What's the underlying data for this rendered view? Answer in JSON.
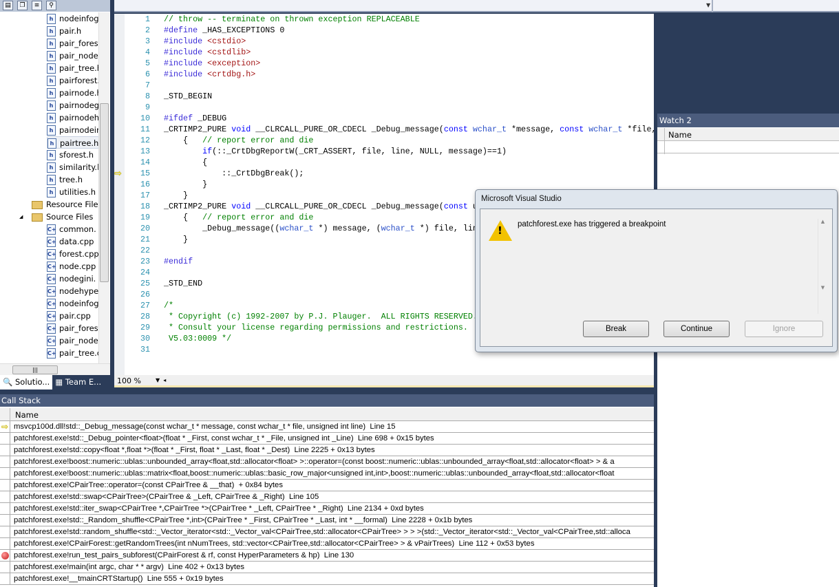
{
  "solution_explorer": {
    "toolbar_icons": [
      "properties-icon",
      "show-all-files-icon",
      "view-code-icon",
      "class-view-icon"
    ],
    "items": [
      {
        "label": "nodeinfog",
        "type": "h",
        "indent": 1
      },
      {
        "label": "pair.h",
        "type": "h",
        "indent": 1
      },
      {
        "label": "pair_forest",
        "type": "h",
        "indent": 1
      },
      {
        "label": "pair_node",
        "type": "h",
        "indent": 1
      },
      {
        "label": "pair_tree.h",
        "type": "h",
        "indent": 1
      },
      {
        "label": "pairforest.",
        "type": "h",
        "indent": 1
      },
      {
        "label": "pairnode.h",
        "type": "h",
        "indent": 1
      },
      {
        "label": "pairnodeg",
        "type": "h",
        "indent": 1
      },
      {
        "label": "pairnodeh",
        "type": "h",
        "indent": 1
      },
      {
        "label": "pairnodeir",
        "type": "h",
        "indent": 1
      },
      {
        "label": "pairtree.h",
        "type": "h",
        "indent": 1,
        "selected": true
      },
      {
        "label": "sforest.h",
        "type": "h",
        "indent": 1
      },
      {
        "label": "similarity.l",
        "type": "h",
        "indent": 1
      },
      {
        "label": "tree.h",
        "type": "h",
        "indent": 1
      },
      {
        "label": "utilities.h",
        "type": "h",
        "indent": 1
      },
      {
        "label": "Resource Files",
        "type": "folder",
        "indent": 0
      },
      {
        "label": "Source Files",
        "type": "folder-open",
        "indent": 0
      },
      {
        "label": "common.",
        "type": "cpp",
        "indent": 1
      },
      {
        "label": "data.cpp",
        "type": "cpp",
        "indent": 1
      },
      {
        "label": "forest.cpp",
        "type": "cpp",
        "indent": 1
      },
      {
        "label": "node.cpp",
        "type": "cpp",
        "indent": 1
      },
      {
        "label": "nodegini.",
        "type": "cpp",
        "indent": 1
      },
      {
        "label": "nodehype",
        "type": "cpp",
        "indent": 1
      },
      {
        "label": "nodeinfog",
        "type": "cpp",
        "indent": 1
      },
      {
        "label": "pair.cpp",
        "type": "cpp",
        "indent": 1
      },
      {
        "label": "pair_forest",
        "type": "cpp",
        "indent": 1
      },
      {
        "label": "pair_node",
        "type": "cpp",
        "indent": 1
      },
      {
        "label": "pair_tree.c",
        "type": "cpp",
        "indent": 1
      }
    ],
    "tabs": [
      {
        "label": "Solutio...",
        "active": true
      },
      {
        "label": "Team E...",
        "active": false
      }
    ]
  },
  "editor": {
    "current_line": 15,
    "zoom": "100 %",
    "lines": [
      [
        [
          "// throw -- terminate on thrown exception REPLACEABLE",
          "cm"
        ]
      ],
      [
        [
          "#define",
          "pp"
        ],
        [
          " _HAS_EXCEPTIONS 0",
          ""
        ]
      ],
      [
        [
          "#include",
          "pp"
        ],
        [
          " ",
          ""
        ],
        [
          "<cstdio>",
          "st"
        ]
      ],
      [
        [
          "#include",
          "pp"
        ],
        [
          " ",
          ""
        ],
        [
          "<cstdlib>",
          "st"
        ]
      ],
      [
        [
          "#include",
          "pp"
        ],
        [
          " ",
          ""
        ],
        [
          "<exception>",
          "st"
        ]
      ],
      [
        [
          "#include",
          "pp"
        ],
        [
          " ",
          ""
        ],
        [
          "<crtdbg.h>",
          "st"
        ]
      ],
      [],
      [
        [
          "_STD_BEGIN",
          ""
        ]
      ],
      [],
      [
        [
          "#ifdef",
          "pp"
        ],
        [
          " _DEBUG",
          ""
        ]
      ],
      [
        [
          "_CRTIMP2_PURE ",
          ""
        ],
        [
          "void",
          "kw"
        ],
        [
          " __CLRCALL_PURE_OR_CDECL _Debug_message(",
          ""
        ],
        [
          "const",
          "kw"
        ],
        [
          " ",
          ""
        ],
        [
          "wchar_t",
          "ty"
        ],
        [
          " *message, ",
          ""
        ],
        [
          "const",
          "kw"
        ],
        [
          " ",
          ""
        ],
        [
          "wchar_t",
          "ty"
        ],
        [
          " *file,",
          ""
        ]
      ],
      [
        [
          "    {   ",
          ""
        ],
        [
          "// report error and die",
          "cm"
        ]
      ],
      [
        [
          "        ",
          ""
        ],
        [
          "if",
          "kw"
        ],
        [
          "(::_CrtDbgReportW(_CRT_ASSERT, file, line, NULL, message)==1)",
          ""
        ]
      ],
      [
        [
          "        {",
          ""
        ]
      ],
      [
        [
          "            ::_CrtDbgBreak();",
          ""
        ]
      ],
      [
        [
          "        }",
          ""
        ]
      ],
      [
        [
          "    }",
          ""
        ]
      ],
      [
        [
          "_CRTIMP2_PURE ",
          ""
        ],
        [
          "void",
          "kw"
        ],
        [
          " __CLRCALL_PURE_OR_CDECL _Debug_message(",
          ""
        ],
        [
          "const",
          "kw"
        ],
        [
          " u",
          ""
        ]
      ],
      [
        [
          "    {   ",
          ""
        ],
        [
          "// report error and die",
          "cm"
        ]
      ],
      [
        [
          "        _Debug_message((",
          ""
        ],
        [
          "wchar_t",
          "ty"
        ],
        [
          " *) message, (",
          ""
        ],
        [
          "wchar_t",
          "ty"
        ],
        [
          " *) file, lin",
          ""
        ]
      ],
      [
        [
          "    }",
          ""
        ]
      ],
      [],
      [
        [
          "#endif",
          "pp"
        ]
      ],
      [],
      [
        [
          "_STD_END",
          ""
        ]
      ],
      [],
      [
        [
          "/*",
          "cm"
        ]
      ],
      [
        [
          " * Copyright (c) 1992-2007 by P.J. Plauger.  ALL RIGHTS RESERVED.",
          "cm"
        ]
      ],
      [
        [
          " * Consult your license regarding permissions and restrictions.",
          "cm"
        ]
      ],
      [
        [
          " V5.03:0009 */",
          "cm"
        ]
      ],
      []
    ]
  },
  "call_stack": {
    "title": "Call Stack",
    "column": "Name",
    "rows": [
      {
        "marker": "current",
        "text": "msvcp100d.dll!std::_Debug_message(const wchar_t * message, const wchar_t * file, unsigned int line)  Line 15"
      },
      {
        "marker": "",
        "text": "patchforest.exe!std::_Debug_pointer<float>(float * _First, const wchar_t * _File, unsigned int _Line)  Line 698 + 0x15 bytes"
      },
      {
        "marker": "",
        "text": "patchforest.exe!std::copy<float *,float *>(float * _First, float * _Last, float * _Dest)  Line 2225 + 0x13 bytes"
      },
      {
        "marker": "",
        "text": "patchforest.exe!boost::numeric::ublas::unbounded_array<float,std::allocator<float> >::operator=(const boost::numeric::ublas::unbounded_array<float,std::allocator<float> > & a"
      },
      {
        "marker": "",
        "text": "patchforest.exe!boost::numeric::ublas::matrix<float,boost::numeric::ublas::basic_row_major<unsigned int,int>,boost::numeric::ublas::unbounded_array<float,std::allocator<float"
      },
      {
        "marker": "",
        "text": "patchforest.exe!CPairTree::operator=(const CPairTree & __that)  + 0x84 bytes"
      },
      {
        "marker": "",
        "text": "patchforest.exe!std::swap<CPairTree>(CPairTree & _Left, CPairTree & _Right)  Line 105"
      },
      {
        "marker": "",
        "text": "patchforest.exe!std::iter_swap<CPairTree *,CPairTree *>(CPairTree * _Left, CPairTree * _Right)  Line 2134 + 0xd bytes"
      },
      {
        "marker": "",
        "text": "patchforest.exe!std::_Random_shuffle<CPairTree *,int>(CPairTree * _First, CPairTree * _Last, int * __formal)  Line 2228 + 0x1b bytes"
      },
      {
        "marker": "",
        "text": "patchforest.exe!std::random_shuffle<std::_Vector_iterator<std::_Vector_val<CPairTree,std::allocator<CPairTree> > > >(std::_Vector_iterator<std::_Vector_val<CPairTree,std::alloca"
      },
      {
        "marker": "",
        "text": "patchforest.exe!CPairForest::getRandomTrees(int nNumTrees, std::vector<CPairTree,std::allocator<CPairTree> > & vPairTrees)  Line 112 + 0x53 bytes"
      },
      {
        "marker": "breakpoint",
        "text": "patchforest.exe!run_test_pairs_subforest(CPairForest & rf, const HyperParameters & hp)  Line 130"
      },
      {
        "marker": "",
        "text": "patchforest.exe!main(int argc, char * * argv)  Line 402 + 0x13 bytes"
      },
      {
        "marker": "",
        "text": "patchforest.exe!__tmainCRTStartup()  Line 555 + 0x19 bytes"
      }
    ]
  },
  "watch": {
    "title": "Watch 2",
    "column": "Name"
  },
  "dialog": {
    "title": "Microsoft Visual Studio",
    "message": "patchforest.exe has triggered a breakpoint",
    "icon": "warning-icon",
    "buttons": [
      {
        "label": "Break",
        "enabled": true
      },
      {
        "label": "Continue",
        "enabled": true
      },
      {
        "label": "Ignore",
        "enabled": false
      }
    ]
  },
  "colors": {
    "chrome": "#2b3c59",
    "panel_title": "#4b5c7d",
    "line_numbers": "#2b91af",
    "comment": "#008000",
    "keyword": "#0000ff",
    "string": "#a31515"
  }
}
